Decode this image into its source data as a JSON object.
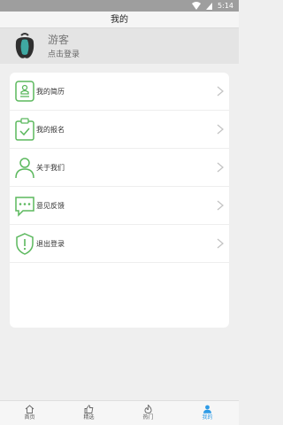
{
  "status_bar": {
    "time": "5:14"
  },
  "header": {
    "title": "我的"
  },
  "profile": {
    "name": "游客",
    "login_prompt": "点击登录"
  },
  "menu": [
    {
      "label": "我的简历",
      "icon": "resume-icon"
    },
    {
      "label": "我的报名",
      "icon": "clipboard-check-icon"
    },
    {
      "label": "关于我们",
      "icon": "person-icon"
    },
    {
      "label": "意见反馈",
      "icon": "chat-bubble-icon"
    },
    {
      "label": "退出登录",
      "icon": "shield-exclamation-icon"
    }
  ],
  "tabs": [
    {
      "label": "首页",
      "icon": "home-icon"
    },
    {
      "label": "精选",
      "icon": "thumbs-up-icon"
    },
    {
      "label": "热门",
      "icon": "flame-icon"
    },
    {
      "label": "我的",
      "icon": "person-icon",
      "active": true
    }
  ],
  "colors": {
    "accent_green": "#5bb85d",
    "tab_active": "#2e9be6"
  }
}
